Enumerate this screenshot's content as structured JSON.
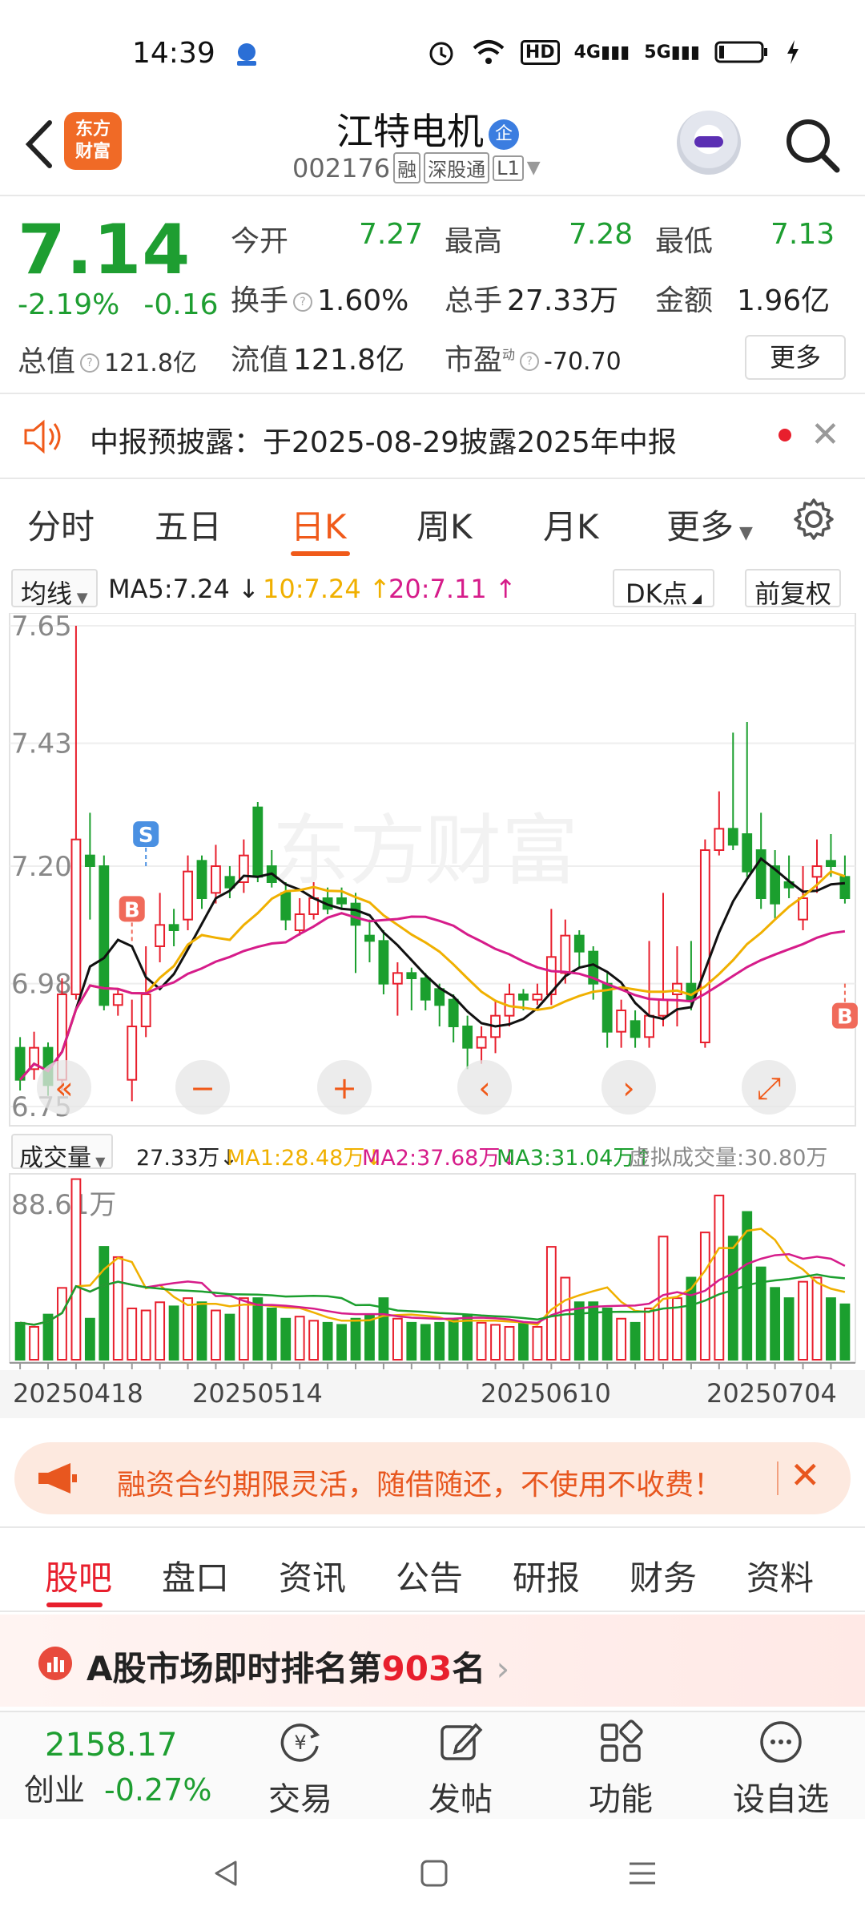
{
  "status": {
    "time": "14:39",
    "net1": "HD",
    "net2": "4G",
    "net3": "5G"
  },
  "header": {
    "logo_line1": "东方",
    "logo_line2": "财富",
    "stock_name": "江特电机",
    "qi_badge": "企",
    "code": "002176",
    "tag_rong": "融",
    "tag_sgt": "深股通",
    "tag_l1": "L1"
  },
  "quote": {
    "price": "7.14",
    "change_pct": "-2.19%",
    "change": "-0.16",
    "total_value_label": "总值",
    "total_value": "121.8亿",
    "open_label": "今开",
    "open": "7.27",
    "high_label": "最高",
    "high": "7.28",
    "low_label": "最低",
    "low": "7.13",
    "turnover_label": "换手",
    "turnover": "1.60%",
    "volume_label": "总手",
    "volume": "27.33万",
    "amount_label": "金额",
    "amount": "1.96亿",
    "float_label": "流值",
    "float_value": "121.8亿",
    "pe_label": "市盈",
    "pe_sup": "动",
    "pe": "-70.70",
    "more_button": "更多"
  },
  "notice": {
    "text": "中报预披露：于2025-08-29披露2025年中报"
  },
  "tabs": [
    "分时",
    "五日",
    "日K",
    "周K",
    "月K",
    "更多"
  ],
  "ma_bar": {
    "selector": "均线",
    "ma5": "MA5:7.24",
    "ma10": "10:7.24",
    "ma20": "20:7.11",
    "dk": "DK点",
    "fq": "前复权"
  },
  "vol_bar": {
    "selector": "成交量",
    "vol": "27.33万",
    "ma1": "MA1:28.48万",
    "ma2": "MA2:37.68万",
    "ma3": "MA3:31.04万",
    "virtual": "虚拟成交量:30.80万"
  },
  "chart_data": {
    "type": "candlestick",
    "y_ticks": [
      "7.65",
      "7.43",
      "7.20",
      "6.98",
      "6.75"
    ],
    "y_range": [
      6.75,
      7.65
    ],
    "vol_max_label": "88.61万",
    "x_labels": [
      "20250418",
      "20250514",
      "20250610",
      "20250704"
    ],
    "markers": [
      {
        "text": "S",
        "color": "#4a90e2"
      },
      {
        "text": "B",
        "color": "#f06a5a"
      },
      {
        "text": "B",
        "color": "#f06a5a"
      }
    ],
    "colors": {
      "up": "#e81f2d",
      "down": "#1b9f2e",
      "ma5": "#111111",
      "ma10": "#f0b000",
      "ma20": "#d61c8a"
    },
    "candles": [
      [
        6.86,
        6.8,
        6.88,
        6.78,
        18
      ],
      [
        6.82,
        6.86,
        6.89,
        6.8,
        16
      ],
      [
        6.86,
        6.79,
        6.87,
        6.77,
        22
      ],
      [
        6.8,
        6.96,
        6.99,
        6.78,
        35
      ],
      [
        6.96,
        7.25,
        7.65,
        6.95,
        88
      ],
      [
        7.22,
        7.2,
        7.3,
        7.1,
        20
      ],
      [
        7.2,
        6.94,
        7.22,
        6.93,
        55
      ],
      [
        6.94,
        6.96,
        6.97,
        6.92,
        50
      ],
      [
        6.8,
        6.9,
        6.95,
        6.76,
        25
      ],
      [
        6.9,
        6.96,
        7.05,
        6.88,
        24
      ],
      [
        7.05,
        7.09,
        7.15,
        7.02,
        28
      ],
      [
        7.09,
        7.08,
        7.12,
        7.05,
        26
      ],
      [
        7.1,
        7.19,
        7.22,
        7.08,
        30
      ],
      [
        7.21,
        7.14,
        7.22,
        7.12,
        28
      ],
      [
        7.15,
        7.2,
        7.24,
        7.13,
        24
      ],
      [
        7.18,
        7.16,
        7.2,
        7.14,
        22
      ],
      [
        7.17,
        7.22,
        7.25,
        7.15,
        30
      ],
      [
        7.31,
        7.18,
        7.32,
        7.17,
        30
      ],
      [
        7.2,
        7.17,
        7.23,
        7.16,
        25
      ],
      [
        7.15,
        7.1,
        7.17,
        7.08,
        20
      ],
      [
        7.08,
        7.11,
        7.14,
        7.07,
        21
      ],
      [
        7.11,
        7.14,
        7.17,
        7.1,
        19
      ],
      [
        7.14,
        7.12,
        7.16,
        7.11,
        18
      ],
      [
        7.14,
        7.13,
        7.16,
        7.12,
        17
      ],
      [
        7.13,
        7.09,
        7.15,
        7.0,
        20
      ],
      [
        7.07,
        7.06,
        7.1,
        7.02,
        22
      ],
      [
        7.06,
        6.98,
        7.08,
        6.96,
        30
      ],
      [
        6.98,
        7.0,
        7.02,
        6.92,
        20
      ],
      [
        7.0,
        6.99,
        7.01,
        6.93,
        18
      ],
      [
        6.99,
        6.95,
        7.0,
        6.93,
        17
      ],
      [
        6.97,
        6.94,
        6.98,
        6.9,
        18
      ],
      [
        6.95,
        6.9,
        6.96,
        6.87,
        20
      ],
      [
        6.9,
        6.86,
        6.92,
        6.82,
        22
      ],
      [
        6.86,
        6.88,
        6.9,
        6.83,
        18
      ],
      [
        6.88,
        6.92,
        6.95,
        6.85,
        17
      ],
      [
        6.92,
        6.96,
        6.98,
        6.9,
        16
      ],
      [
        6.96,
        6.95,
        6.97,
        6.93,
        18
      ],
      [
        6.95,
        6.96,
        6.98,
        6.94,
        16
      ],
      [
        6.96,
        7.03,
        7.12,
        6.94,
        55
      ],
      [
        7.0,
        7.07,
        7.1,
        6.98,
        40
      ],
      [
        7.07,
        7.04,
        7.08,
        7.01,
        28
      ],
      [
        7.04,
        6.98,
        7.05,
        6.95,
        28
      ],
      [
        6.98,
        6.89,
        7.0,
        6.86,
        25
      ],
      [
        6.89,
        6.93,
        6.95,
        6.86,
        20
      ],
      [
        6.91,
        6.88,
        6.93,
        6.86,
        18
      ],
      [
        6.88,
        6.92,
        7.06,
        6.86,
        25
      ],
      [
        6.92,
        6.95,
        7.15,
        6.9,
        60
      ],
      [
        6.96,
        6.98,
        7.05,
        6.9,
        30
      ],
      [
        6.98,
        6.95,
        7.06,
        6.93,
        40
      ],
      [
        6.87,
        7.23,
        7.25,
        6.86,
        62
      ],
      [
        7.23,
        7.27,
        7.34,
        7.22,
        80
      ],
      [
        7.27,
        7.24,
        7.45,
        7.23,
        60
      ],
      [
        7.26,
        7.19,
        7.47,
        7.18,
        72
      ],
      [
        7.23,
        7.14,
        7.3,
        7.12,
        45
      ],
      [
        7.2,
        7.13,
        7.23,
        7.1,
        35
      ],
      [
        7.17,
        7.16,
        7.22,
        7.14,
        30
      ],
      [
        7.1,
        7.14,
        7.2,
        7.08,
        38
      ],
      [
        7.18,
        7.2,
        7.25,
        7.15,
        40
      ],
      [
        7.21,
        7.2,
        7.26,
        7.18,
        30
      ],
      [
        7.18,
        7.14,
        7.22,
        7.13,
        27
      ]
    ]
  },
  "promo": {
    "text": "融资合约期限灵活，随借随还，不使用不收费！"
  },
  "bottom_tabs": [
    "股吧",
    "盘口",
    "资讯",
    "公告",
    "研报",
    "财务",
    "资料"
  ],
  "rank": {
    "prefix": "A股市场即时排名第",
    "num": "903",
    "suffix": "名"
  },
  "bottom_bar": {
    "index_value": "2158.17",
    "index_name": "创业",
    "index_pct": "-0.27%",
    "trade": "交易",
    "post": "发帖",
    "func": "功能",
    "watch": "设自选"
  }
}
